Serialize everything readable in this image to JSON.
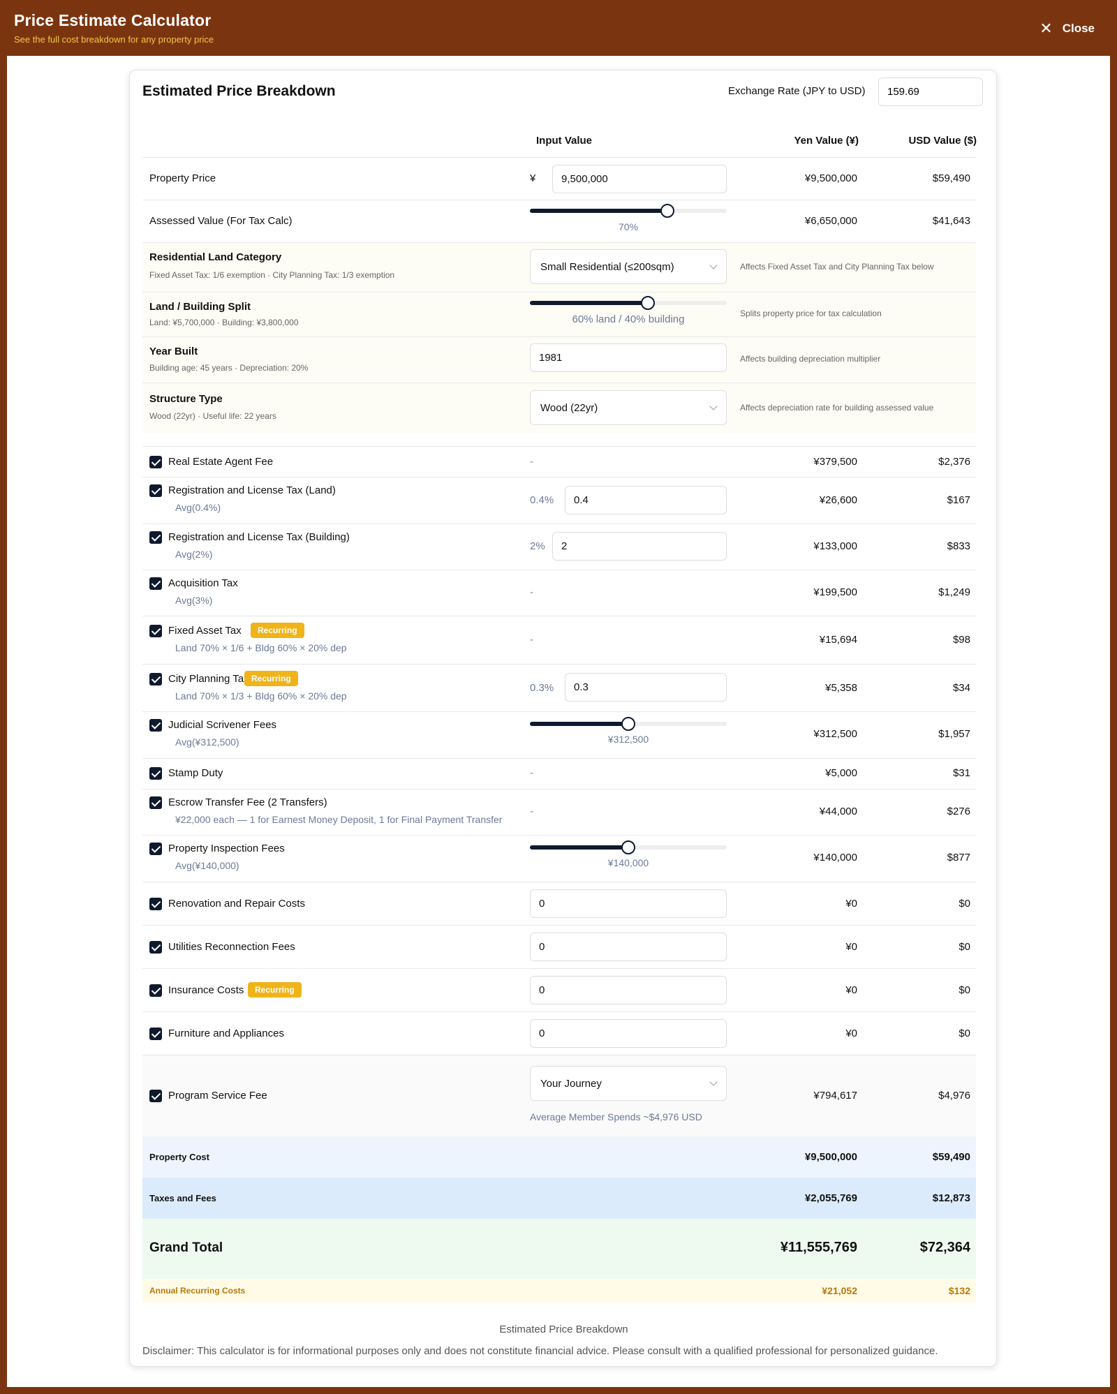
{
  "header": {
    "title": "Price Estimate Calculator",
    "subtitle": "See the full cost breakdown for any property price",
    "close_label": "Close"
  },
  "card": {
    "title": "Estimated Price Breakdown",
    "rate_label": "Exchange Rate (JPY to USD)",
    "rate_value": "159.69"
  },
  "columns": {
    "input": "Input Value",
    "yen": "Yen Value (¥)",
    "usd": "USD Value ($)"
  },
  "property_price": {
    "label": "Property Price",
    "prefix": "¥",
    "value": "9,500,000",
    "yen": "¥9,500,000",
    "usd": "$59,490"
  },
  "assessed": {
    "label": "Assessed Value (For Tax Calc)",
    "slider_fraction": 0.7,
    "slider_label": "70%",
    "yen": "¥6,650,000",
    "usd": "$41,643"
  },
  "land_category": {
    "label": "Residential Land Category",
    "sub": "Fixed Asset Tax: 1/6 exemption · City Planning Tax: 1/3 exemption",
    "value": "Small Residential (≤200sqm)",
    "note": "Affects Fixed Asset Tax and City Planning Tax below"
  },
  "split": {
    "label": "Land / Building Split",
    "sub": "Land: ¥5,700,000 · Building: ¥3,800,000",
    "slider_fraction": 0.6,
    "slider_label": "60% land / 40% building",
    "note": "Splits property price for tax calculation"
  },
  "year_built": {
    "label": "Year Built",
    "sub": "Building age: 45 years · Depreciation: 20%",
    "value": "1981",
    "note": "Affects building depreciation multiplier"
  },
  "structure": {
    "label": "Structure Type",
    "sub": "Wood (22yr) · Useful life: 22 years",
    "value": "Wood (22yr)",
    "note": "Affects depreciation rate for building assessed value"
  },
  "items": {
    "agent": {
      "label": "Real Estate Agent Fee",
      "dash": "-",
      "yen": "¥379,500",
      "usd": "$2,376"
    },
    "reg_land": {
      "label": "Registration and License Tax (Land)",
      "avg": "Avg(0.4%)",
      "pct": "0.4%",
      "value": "0.4",
      "yen": "¥26,600",
      "usd": "$167"
    },
    "reg_bldg": {
      "label": "Registration and License Tax (Building)",
      "avg": "Avg(2%)",
      "pct": "2%",
      "value": "2",
      "yen": "¥133,000",
      "usd": "$833"
    },
    "acq": {
      "label": "Acquisition Tax",
      "avg": "Avg(3%)",
      "dash": "-",
      "yen": "¥199,500",
      "usd": "$1,249"
    },
    "fixed": {
      "label": "Fixed Asset Tax",
      "badge": "Recurring",
      "avg": "Land 70% × 1/6 + Bldg 60% × 20% dep",
      "dash": "-",
      "yen": "¥15,694",
      "usd": "$98"
    },
    "city": {
      "label": "City Planning Tax",
      "badge": "Recurring",
      "avg": "Land 70% × 1/3 + Bldg 60% × 20% dep",
      "pct": "0.3%",
      "value": "0.3",
      "yen": "¥5,358",
      "usd": "$34"
    },
    "scrivener": {
      "label": "Judicial Scrivener Fees",
      "avg": "Avg(¥312,500)",
      "slider_fraction": 0.5,
      "slider_label": "¥312,500",
      "yen": "¥312,500",
      "usd": "$1,957"
    },
    "stamp": {
      "label": "Stamp Duty",
      "dash": "-",
      "yen": "¥5,000",
      "usd": "$31"
    },
    "escrow": {
      "label": "Escrow Transfer Fee (2 Transfers)",
      "avg": "¥22,000 each — 1 for Earnest Money Deposit, 1 for Final Payment Transfer",
      "dash": "-",
      "yen": "¥44,000",
      "usd": "$276"
    },
    "inspection": {
      "label": "Property Inspection Fees",
      "avg": "Avg(¥140,000)",
      "slider_fraction": 0.5,
      "slider_label": "¥140,000",
      "yen": "¥140,000",
      "usd": "$877"
    },
    "renovation": {
      "label": "Renovation and Repair Costs",
      "value": "0",
      "yen": "¥0",
      "usd": "$0"
    },
    "utilities": {
      "label": "Utilities Reconnection Fees",
      "value": "0",
      "yen": "¥0",
      "usd": "$0"
    },
    "insurance": {
      "label": "Insurance Costs",
      "badge": "Recurring",
      "value": "0",
      "yen": "¥0",
      "usd": "$0"
    },
    "furniture": {
      "label": "Furniture and Appliances",
      "value": "0",
      "yen": "¥0",
      "usd": "$0"
    },
    "program": {
      "label": "Program Service Fee",
      "value": "Your Journey",
      "note": "Average Member Spends ~$4,976 USD",
      "yen": "¥794,617",
      "usd": "$4,976"
    }
  },
  "totals": {
    "property": {
      "label": "Property Cost",
      "yen": "¥9,500,000",
      "usd": "$59,490"
    },
    "taxes": {
      "label": "Taxes and Fees",
      "yen": "¥2,055,769",
      "usd": "$12,873"
    },
    "grand": {
      "label": "Grand Total",
      "yen": "¥11,555,769",
      "usd": "$72,364"
    },
    "annual": {
      "label": "Annual Recurring Costs",
      "yen": "¥21,052",
      "usd": "$132"
    }
  },
  "footer": {
    "title": "Estimated Price Breakdown",
    "disclaimer": "Disclaimer: This calculator is for informational purposes only and does not constitute financial advice. Please consult with a qualified professional for personalized guidance."
  },
  "colors": {
    "header_bg": "#7a3510",
    "accent_yellow": "#f0b31a",
    "dark_navy": "#0f1a2e",
    "grand_total_bg": "#eefaf0",
    "taxes_bg": "#dcebfc",
    "property_bg": "#eef4fd",
    "annual_bg": "#fffbe6"
  }
}
